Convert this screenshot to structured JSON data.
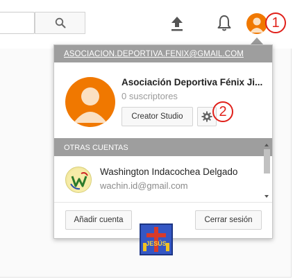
{
  "header": {
    "search_placeholder": "",
    "icons": [
      "search-icon",
      "upload-icon",
      "bell-icon",
      "avatar"
    ]
  },
  "annotations": {
    "one": "1",
    "two": "2"
  },
  "account_menu": {
    "email": "ASOCIACION.DEPORTIVA.FENIX@GMAIL.COM",
    "name": "Asociación Deportiva Fénix Ji...",
    "subscribers": "0 suscriptores",
    "creator_studio_label": "Creator Studio",
    "other_accounts_label": "OTRAS CUENTAS",
    "other_accounts": [
      {
        "name": "Washington Indacochea Delgado",
        "email": "wachin.id@gmail.com"
      }
    ],
    "add_account_label": "Añadir cuenta",
    "sign_out_label": "Cerrar sesión"
  },
  "logo": {
    "text": "JESÚS"
  },
  "colors": {
    "avatar_orange": "#f07800",
    "bar_gray": "#9e9e9e",
    "annotation_red": "#e0201a"
  }
}
